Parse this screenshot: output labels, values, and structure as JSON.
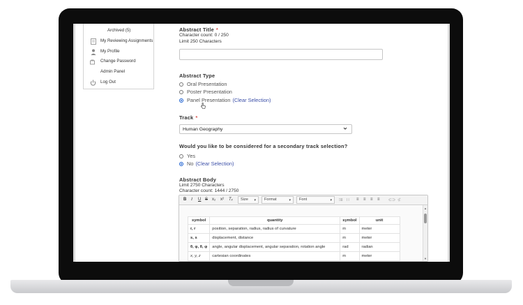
{
  "sidebar": {
    "items": [
      {
        "label": "Archived (5)",
        "icon": ""
      },
      {
        "label": "My Reviewing Assignments",
        "icon": "document-icon"
      },
      {
        "label": "My Profile",
        "icon": "user-icon"
      },
      {
        "label": "Change Password",
        "icon": "key-icon"
      },
      {
        "label": "Admin Panel",
        "icon": ""
      },
      {
        "label": "Log Out",
        "icon": "power-icon"
      }
    ]
  },
  "form": {
    "title_label": "Abstract Title",
    "required_mark": "*",
    "title_count": "Character count: 0 / 250",
    "title_limit": "Limit 250 Characters",
    "title_value": "",
    "type_label": "Abstract Type",
    "type_options": [
      "Oral Presentation",
      "Poster Presentation",
      "Panel Presentation"
    ],
    "type_selected": "Panel Presentation",
    "clear_selection": "(Clear Selection)",
    "track_label": "Track",
    "track_value": "Human Geography",
    "secondary_question": "Would you like to be considered for a secondary track selection?",
    "secondary_options": [
      "Yes",
      "No"
    ],
    "secondary_selected": "No",
    "body_label": "Abstract Body",
    "body_limit": "Limit 2750 Characters",
    "body_count": "Character count: 1444 / 2750"
  },
  "editor": {
    "toolbar": {
      "bold": "B",
      "italic": "I",
      "underline": "U",
      "strike": "S",
      "subscript": "x₂",
      "superscript": "x²",
      "clear_format": "Tₓ",
      "size": "Size",
      "format": "Format",
      "font": "Font"
    },
    "table": {
      "headers": [
        "symbol",
        "quantity",
        "symbol",
        "unit"
      ],
      "rows": [
        [
          "r, r",
          "position, separation, radius, radius of curvature",
          "m",
          "meter"
        ],
        [
          "s, s",
          "displacement, distance",
          "m",
          "meter"
        ],
        [
          "θ, φ, θ, φ",
          "angle, angular displacement, angular separation, rotation angle",
          "rad",
          "radian"
        ],
        [
          "x, y, z",
          "cartesian coordinates",
          "m",
          "meter"
        ]
      ]
    }
  },
  "colors": {
    "required": "#d9534f",
    "link": "#3b4fa8",
    "radio_selected": "#1a5fd0"
  }
}
